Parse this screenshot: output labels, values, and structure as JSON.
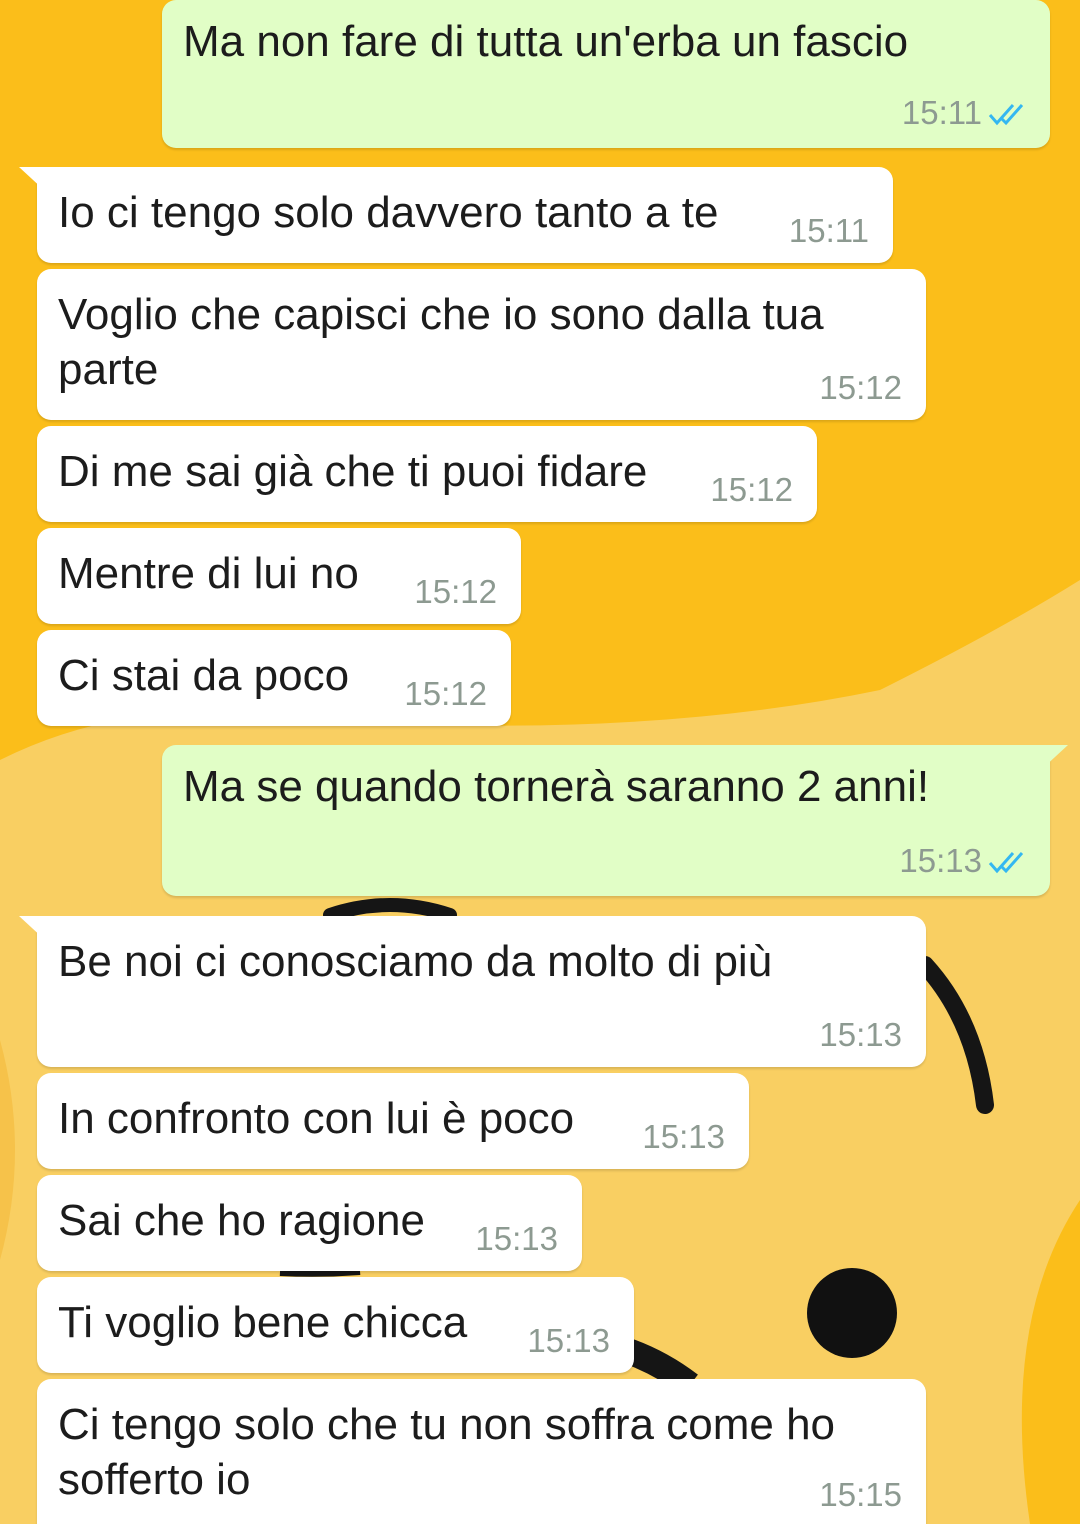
{
  "chat": {
    "messages": [
      {
        "direction": "out",
        "text": "Ma non fare di tutta un'erba un fascio",
        "time": "15:11",
        "status_icon": "double-check-read-icon"
      },
      {
        "direction": "in",
        "text": "Io ci tengo solo davvero tanto a te",
        "time": "15:11"
      },
      {
        "direction": "in",
        "text": "Voglio che capisci che io sono dalla tua parte",
        "time": "15:12"
      },
      {
        "direction": "in",
        "text": "Di me sai già che ti puoi fidare",
        "time": "15:12"
      },
      {
        "direction": "in",
        "text": "Mentre di lui no",
        "time": "15:12"
      },
      {
        "direction": "in",
        "text": "Ci stai da poco",
        "time": "15:12"
      },
      {
        "direction": "out",
        "text": "Ma se quando tornerà saranno 2 anni!",
        "time": "15:13",
        "status_icon": "double-check-read-icon"
      },
      {
        "direction": "in",
        "text": "Be noi ci conosciamo da molto di più",
        "time": "15:13"
      },
      {
        "direction": "in",
        "text": "In confronto con lui è poco",
        "time": "15:13"
      },
      {
        "direction": "in",
        "text": "Sai che ho ragione",
        "time": "15:13"
      },
      {
        "direction": "in",
        "text": "Ti voglio bene chicca",
        "time": "15:13"
      },
      {
        "direction": "in",
        "text": "Ci tengo solo che tu non soffra come ho sofferto io",
        "time": "15:15"
      }
    ]
  },
  "colors": {
    "wallpaper_yellow": "#FBBE1A",
    "wallpaper_pale": "#F9CF62",
    "incoming_bubble": "#FFFFFF",
    "outgoing_bubble": "#E1FEC6",
    "timestamp": "#8D9A91",
    "read_ticks": "#34B7F1"
  }
}
